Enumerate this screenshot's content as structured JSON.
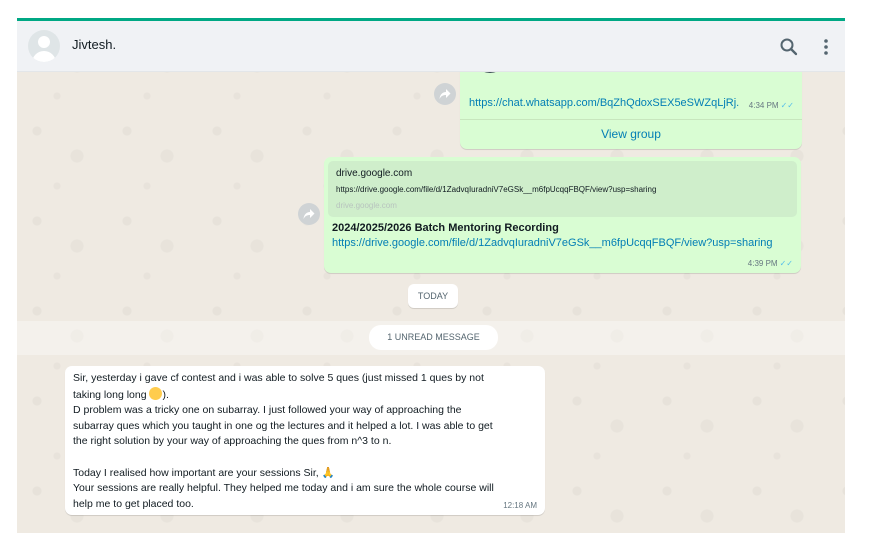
{
  "header": {
    "contact_name": "Jivtesh.",
    "search_icon": "search-icon",
    "menu_icon": "more-vertical-icon"
  },
  "messages": [
    {
      "type": "group_invite",
      "link": "https://chat.whatsapp.com/BqZhQdoxSEX5eSWZqLjRj.",
      "time": "4:34 PM",
      "action": "View group",
      "status": "read"
    },
    {
      "type": "link_preview",
      "preview_domain": "drive.google.com",
      "preview_url": "https://drive.google.com/file/d/1ZadvqIuradniV7eGSk__m6fpUcqqFBQF/view?usp=sharing",
      "preview_site": "drive.google.com",
      "title": "2024/2025/2026 Batch Mentoring Recording",
      "url": "https://drive.google.com/file/d/1ZadvqIuradniV7eGSk__m6fpUcqqFBQF/view?usp=sharing",
      "time": "4:39 PM",
      "status": "read"
    }
  ],
  "date_separator": "TODAY",
  "unread_label": "1 UNREAD MESSAGE",
  "incoming_message": {
    "line1": "Sir, yesterday i gave cf contest and i was able to solve 5 ques (just missed 1 ques by not",
    "line2_text": "taking long long ",
    "line2_end": ").",
    "line3": "D problem was a tricky one on subarray. I just followed your way of approaching the",
    "line4": "subarray ques which you taught in one og the lectures and it helped a lot. I was able to get",
    "line5": "the right solution by your way of approaching the ques from n^3 to n.",
    "line6": "Today I realised how important are your sessions Sir, 🙏",
    "line7": "Your sessions are really helpful. They helped me today and i am sure the whole course will",
    "line8": "help me to get placed too.",
    "time": "12:18 AM"
  },
  "icons": {
    "forward": "forward-arrow-icon",
    "read_ticks": "✓✓"
  }
}
